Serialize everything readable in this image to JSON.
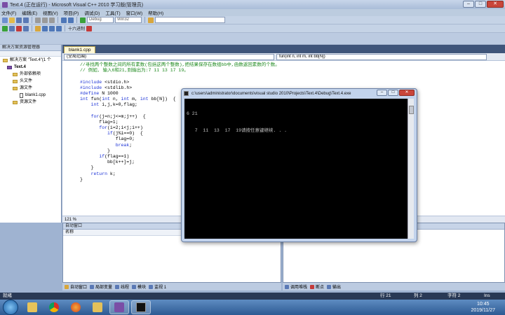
{
  "window": {
    "title": "Text.4 (正在运行) - Microsoft Visual C++ 2010 学习版(管理员)"
  },
  "menu": [
    "文件(F)",
    "编辑(E)",
    "视图(V)",
    "项目(P)",
    "调试(D)",
    "工具(T)",
    "窗口(W)",
    "帮助(H)"
  ],
  "toolbar": {
    "config": "Debug",
    "platform": "Win32",
    "hex_label": "十六进制"
  },
  "solution": {
    "title": "解决方案资源管理器",
    "items": [
      "解决方案 \"Text.4\"(1 个",
      "Text.4",
      "外部依赖项",
      "头文件",
      "源文件",
      "blank1.cpp",
      "资源文件"
    ]
  },
  "editor": {
    "tab": "blank1.cpp",
    "scope": "(全局范围)",
    "function": "fun(int n, int m, int bb[N])",
    "zoom": "121 %",
    "lines": [
      [
        [
          "cm",
          "//寻找两个整数之间的所有素数(包括这两个整数),把结果保存在数组bb中,函数返回素数的个数。"
        ]
      ],
      [
        [
          "cm",
          "// 例如, 输入6和21,则输出为:7 11 13 17 19。"
        ]
      ],
      [
        [
          "tx",
          ""
        ]
      ],
      [
        [
          "pp",
          "#include "
        ],
        [
          "tx",
          "<stdio.h>"
        ]
      ],
      [
        [
          "pp",
          "#include "
        ],
        [
          "tx",
          "<stdlib.h>"
        ]
      ],
      [
        [
          "pp",
          "#define "
        ],
        [
          "tx",
          "N 1000"
        ]
      ],
      [
        [
          "kw",
          "int "
        ],
        [
          "tx",
          "fun("
        ],
        [
          "kw",
          "int "
        ],
        [
          "tx",
          "n, "
        ],
        [
          "kw",
          "int "
        ],
        [
          "tx",
          "m, "
        ],
        [
          "kw",
          "int "
        ],
        [
          "tx",
          "bb[N])  {"
        ]
      ],
      [
        [
          "tx",
          "    "
        ],
        [
          "kw",
          "int "
        ],
        [
          "tx",
          "i,j,k=0,flag;"
        ]
      ],
      [
        [
          "tx",
          ""
        ]
      ],
      [
        [
          "tx",
          "    "
        ],
        [
          "kw",
          "for"
        ],
        [
          "tx",
          "(j=n;j<=m;j++)  {"
        ]
      ],
      [
        [
          "tx",
          "       flag=1;"
        ]
      ],
      [
        [
          "tx",
          "       "
        ],
        [
          "kw",
          "for"
        ],
        [
          "tx",
          "(i=2;i<j;i++)"
        ]
      ],
      [
        [
          "tx",
          "          "
        ],
        [
          "kw",
          "if"
        ],
        [
          "tx",
          "(j%i==0)  {"
        ]
      ],
      [
        [
          "tx",
          "             flag=0;"
        ]
      ],
      [
        [
          "tx",
          "             "
        ],
        [
          "kw",
          "break"
        ],
        [
          "tx",
          ";"
        ]
      ],
      [
        [
          "tx",
          "          }"
        ]
      ],
      [
        [
          "tx",
          "       "
        ],
        [
          "kw",
          "if"
        ],
        [
          "tx",
          "(flag==1)"
        ]
      ],
      [
        [
          "tx",
          "          bb[k++]=j;"
        ]
      ],
      [
        [
          "tx",
          "    }"
        ]
      ],
      [
        [
          "tx",
          "    "
        ],
        [
          "kw",
          "return "
        ],
        [
          "tx",
          "k;"
        ]
      ],
      [
        [
          "tx",
          "}"
        ]
      ]
    ]
  },
  "output_panel": {
    "title": "自动窗口",
    "column": "名称"
  },
  "bottom_tabs_left": [
    "自动窗口",
    "局部变量",
    "线程",
    "模块",
    "监视 1"
  ],
  "bottom_tabs_right": [
    "调用堆栈",
    "断点",
    "输出"
  ],
  "console": {
    "title": "c:\\users\\administrator\\documents\\visual studio 2010\\Projects\\Text.4\\Debug\\Text.4.exe",
    "lines": [
      "6 21",
      "   7  11  13  17  19请按任意键继续. . ."
    ]
  },
  "status": {
    "left": "就绪",
    "line": "行 21",
    "col": "列 2",
    "char": "字符 2",
    "mode": "Ins"
  },
  "clock": {
    "time": "10:45",
    "date": "2019/11/27"
  },
  "colors": {
    "accent": "#7a4ea6",
    "statusbar": "#293955",
    "code_comment": "#1f8a1f",
    "code_keyword": "#1b32d6"
  }
}
